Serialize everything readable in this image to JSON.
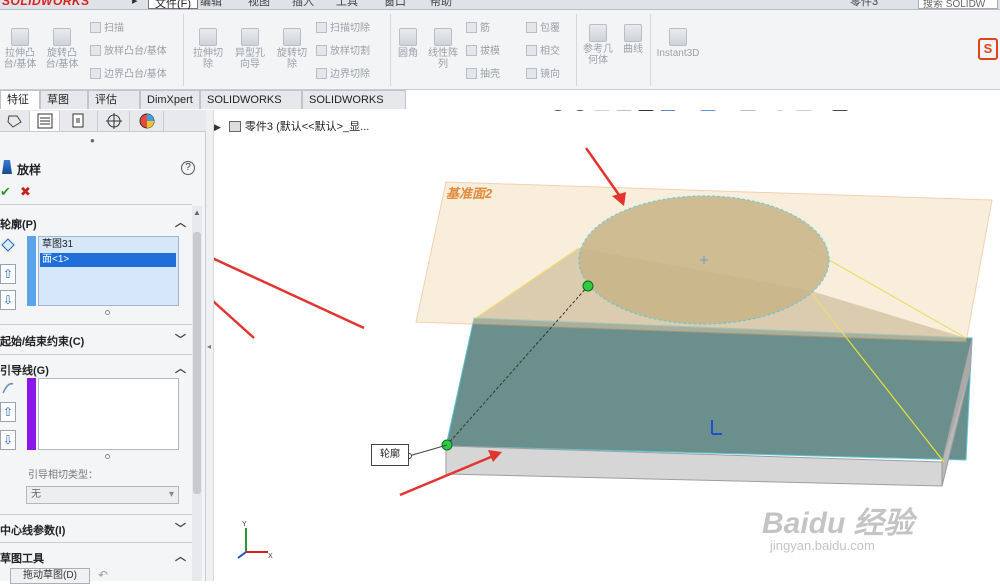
{
  "titlebar": {
    "logo": "SOLIDWORKS",
    "file_menu": "文件(F)",
    "menus_cut": [
      "编辑",
      "视图",
      "插入",
      "工具",
      "窗口",
      "帮助"
    ],
    "right_cut": "零件3",
    "search_placeholder": "搜索 SOLIDW"
  },
  "ribbon": {
    "big_buttons": [
      {
        "label": "拉伸凸\n台/基体"
      },
      {
        "label": "旋转凸\n台/基体"
      },
      {
        "label": "拉伸切\n除"
      },
      {
        "label": "异型孔\n向导"
      },
      {
        "label": "旋转切\n除"
      },
      {
        "label": "圆角"
      },
      {
        "label": "线性阵\n列"
      },
      {
        "label": "参考几\n何体"
      },
      {
        "label": "曲线"
      },
      {
        "label": "Instant3D"
      }
    ],
    "small_buttons": {
      "sweep": "扫描",
      "loft": "放样凸台/基体",
      "boundary": "边界凸台/基体",
      "sweep_cut": "扫描切除",
      "loft_cut": "放样切割",
      "boundary_cut": "边界切除",
      "rib": "筋",
      "draft": "拔模",
      "shell": "抽壳",
      "wrap": "包覆",
      "intersect": "相交",
      "mirror": "镜向"
    }
  },
  "tabs": [
    "特征",
    "草图",
    "评估",
    "DimXpert",
    "SOLIDWORKS 插件",
    "SOLIDWORKS MBD"
  ],
  "property_manager": {
    "title": "放样",
    "help": "?",
    "ok": "✔",
    "cancel": "✖",
    "profiles": {
      "header": "轮廓(P)",
      "items": [
        "草图31",
        "面<1>"
      ],
      "selected_index": 1
    },
    "constraints": {
      "header": "起始/结束约束(C)"
    },
    "guides": {
      "header": "引导线(G)",
      "tangency_label": "引导相切类型：",
      "tangency_value": "无"
    },
    "centerline": {
      "header": "中心线参数(I)"
    },
    "sketch_tools": {
      "header": "草图工具",
      "drag_button": "拖动草图(D)"
    }
  },
  "viewport": {
    "breadcrumb": "零件3 (默认<<默认>_显...",
    "plane_label": "基准面2",
    "callout": "轮廓",
    "watermark": "Baidu 经验",
    "watermark_url": "jingyan.baidu.com"
  },
  "colors": {
    "accent_red": "#e3342f",
    "plane_orange": "#e08a3c",
    "selection_blue": "#1e6fd9",
    "guide_purple": "#8b16e6",
    "profile_blue": "#5aa5ea"
  }
}
